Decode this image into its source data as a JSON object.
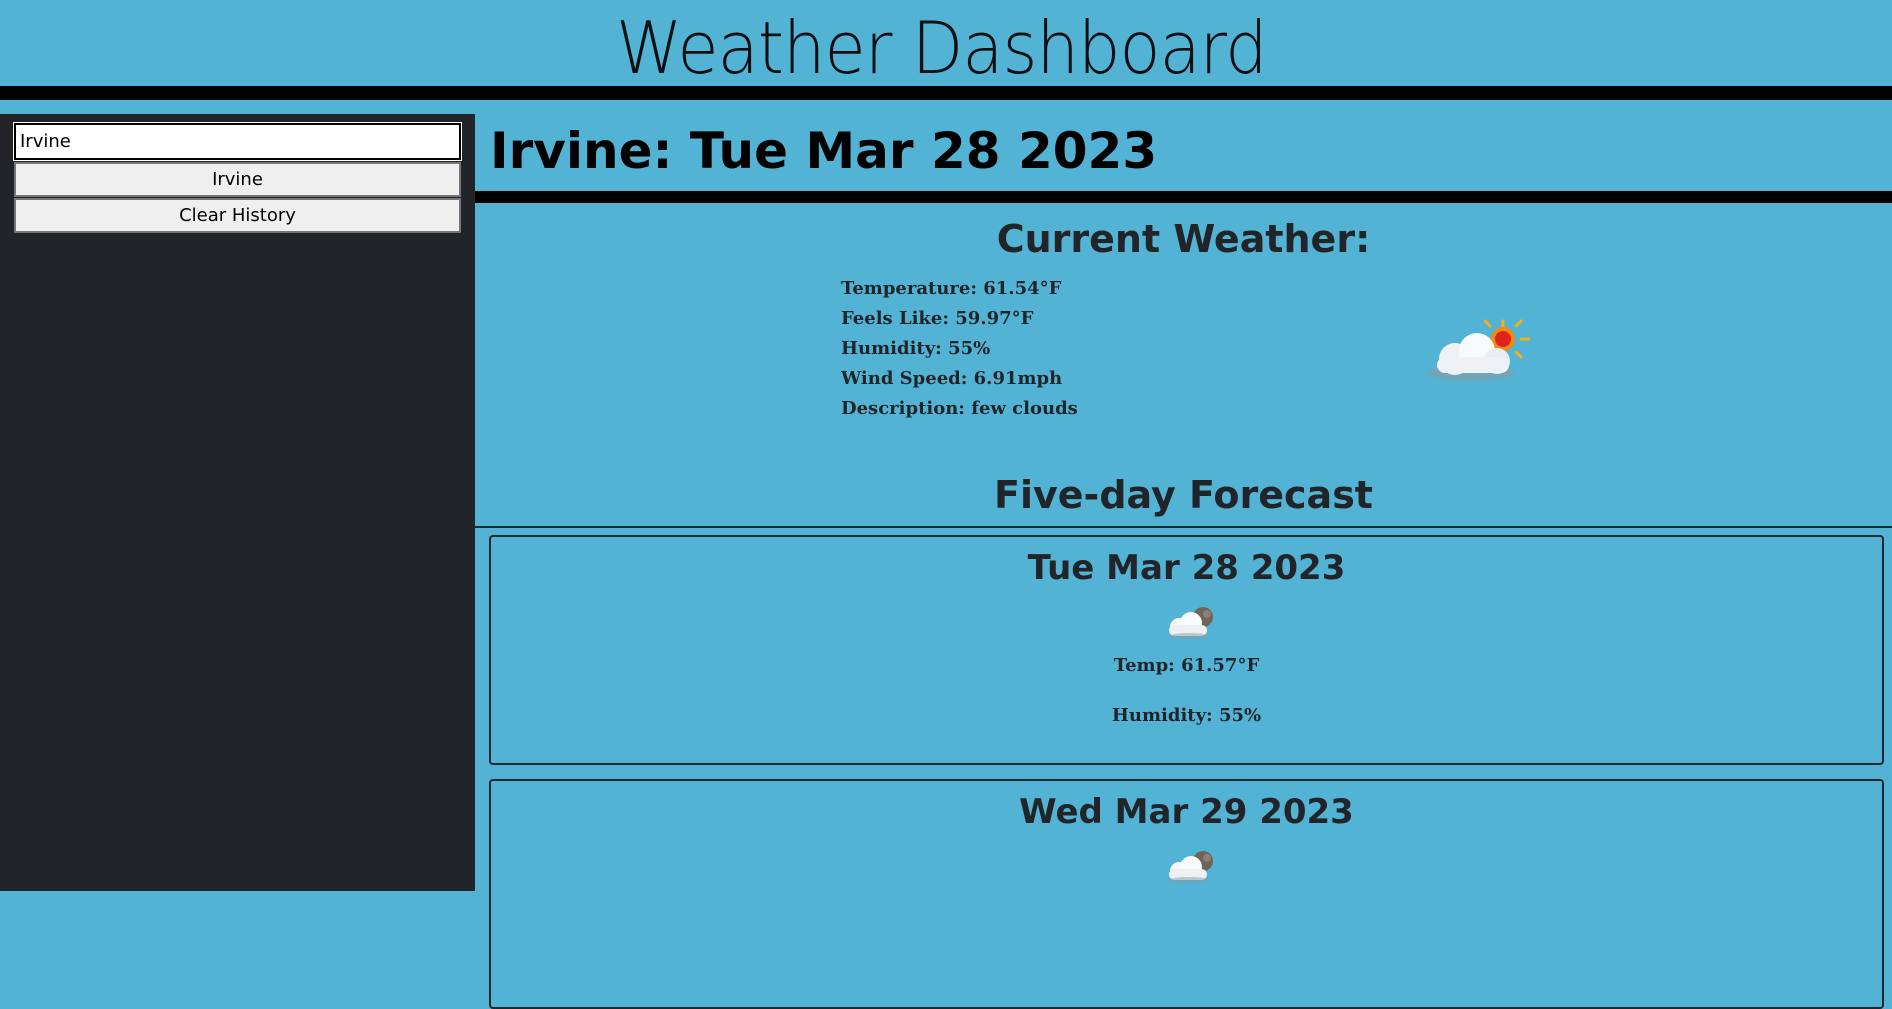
{
  "header": {
    "title": "Weather Dashboard"
  },
  "sidebar": {
    "search_value": "Irvine",
    "history": [
      "Irvine"
    ],
    "clear_label": "Clear History"
  },
  "main": {
    "city_date": "Irvine: Tue Mar 28 2023",
    "current": {
      "heading": "Current Weather:",
      "temperature": "Temperature: 61.54°F",
      "feels_like": "Feels Like: 59.97°F",
      "humidity": "Humidity: 55%",
      "wind": "Wind Speed: 6.91mph",
      "description": "Description: few clouds",
      "icon": "few-clouds-day-icon"
    },
    "forecast": {
      "heading": "Five-day Forecast",
      "days": [
        {
          "date": "Tue Mar 28 2023",
          "icon": "few-clouds-night-icon",
          "temp": "Temp: 61.57°F",
          "humidity": "Humidity: 55%"
        },
        {
          "date": "Wed Mar 29 2023",
          "icon": "few-clouds-night-icon"
        }
      ]
    }
  },
  "colors": {
    "background": "#53b3d5",
    "sidebar": "#212529",
    "text": "#212529",
    "divider": "#000000"
  }
}
